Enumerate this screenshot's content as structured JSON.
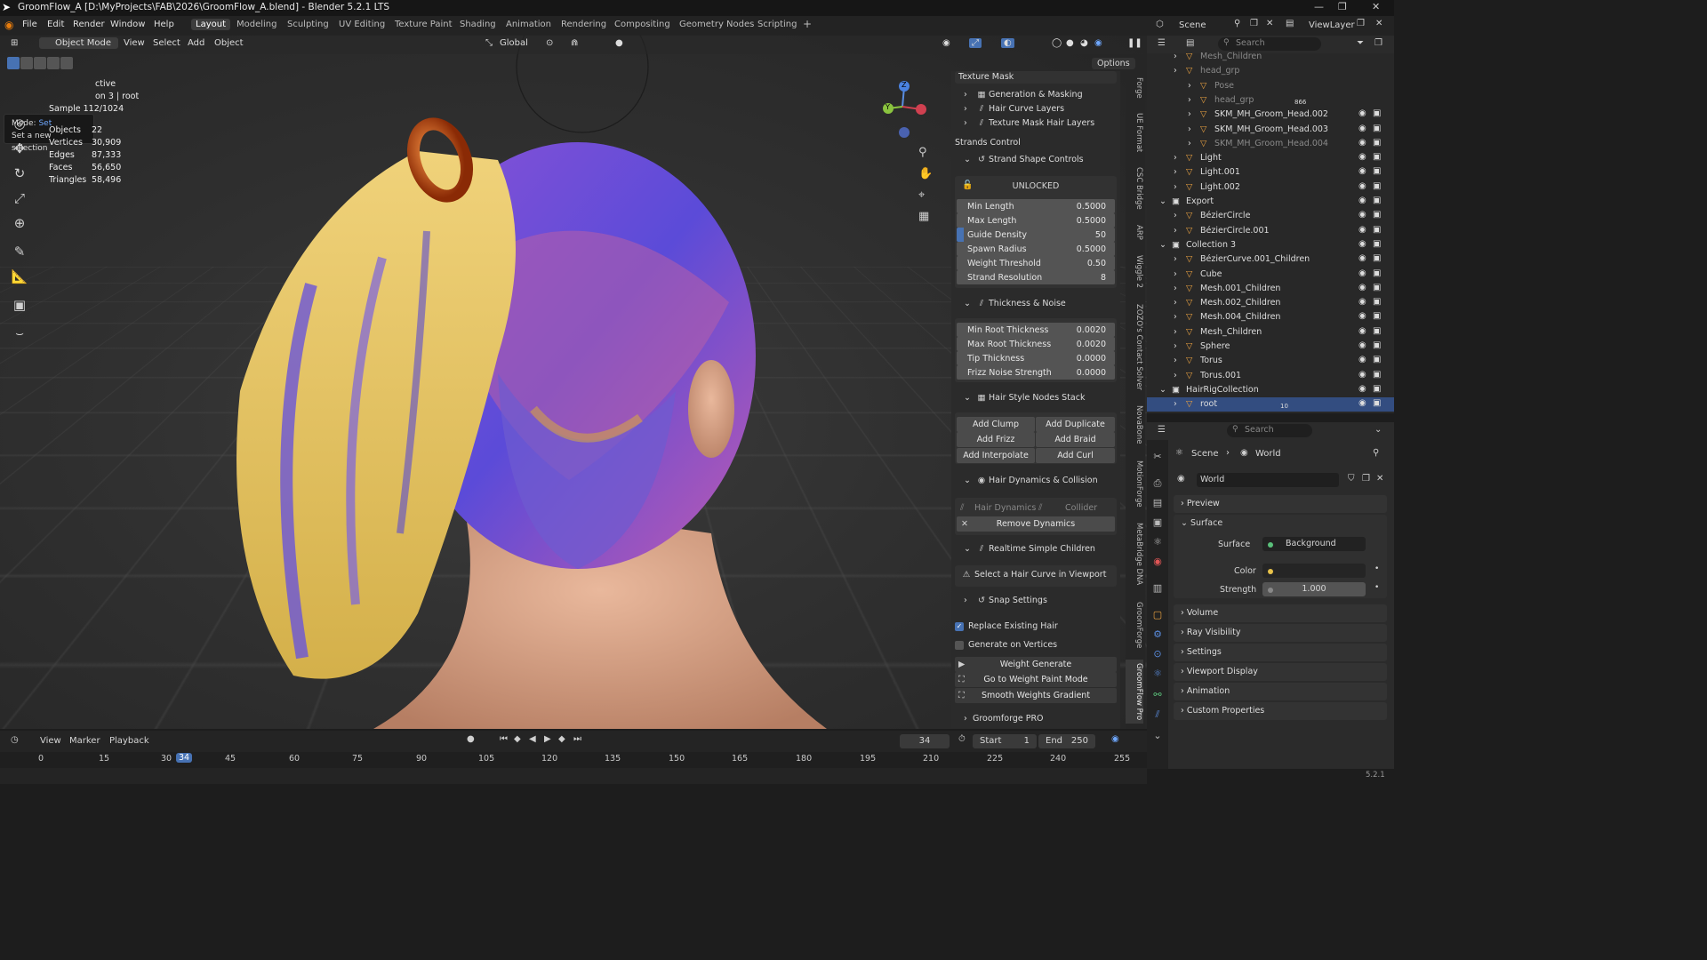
{
  "titlebar": {
    "title": "GroomFlow_A [D:\\MyProjects\\FAB\\2026\\GroomFlow_A.blend] - Blender 5.2.1 LTS"
  },
  "menu": [
    "File",
    "Edit",
    "Render",
    "Window",
    "Help"
  ],
  "workspaces": [
    "Layout",
    "Modeling",
    "Sculpting",
    "UV Editing",
    "Texture Paint",
    "Shading",
    "Animation",
    "Rendering",
    "Compositing",
    "Geometry Nodes",
    "Scripting"
  ],
  "scene": {
    "name": "Scene",
    "viewlayer": "ViewLayer"
  },
  "viewport": {
    "mode": "Object Mode",
    "view": "View",
    "select": "Select",
    "add": "Add",
    "object": "Object",
    "orientation": "Global",
    "options": "Options",
    "tooltip": {
      "line1_label": "Mode:",
      "line1_value": "Set",
      "line2": "Set a new selection"
    },
    "overlay_partial1": "ctive",
    "overlay_partial2": "on 3 | root",
    "sample": "Sample 112/1024",
    "stats": [
      {
        "k": "Objects",
        "v": "22"
      },
      {
        "k": "Vertices",
        "v": "30,909"
      },
      {
        "k": "Edges",
        "v": "87,333"
      },
      {
        "k": "Faces",
        "v": "56,650"
      },
      {
        "k": "Triangles",
        "v": "58,496"
      }
    ],
    "gizmo": {
      "z": "Z",
      "y": "Y"
    }
  },
  "npanel": {
    "texture_mask": "Texture Mask",
    "gen_masking": "Generation & Masking",
    "hair_curve_layers": "Hair Curve Layers",
    "texture_mask_layers": "Texture Mask Hair Layers",
    "strands_control": "Strands Control",
    "strand_shape": "Strand Shape Controls",
    "unlocked": "UNLOCKED",
    "shape_props": [
      {
        "k": "Min Length",
        "v": "0.5000"
      },
      {
        "k": "Max Length",
        "v": "0.5000"
      },
      {
        "k": "Guide Density",
        "v": "50"
      },
      {
        "k": "Spawn Radius",
        "v": "0.5000"
      },
      {
        "k": "Weight Threshold",
        "v": "0.50"
      },
      {
        "k": "Strand Resolution",
        "v": "8"
      }
    ],
    "thickness_noise": "Thickness & Noise",
    "thick_props": [
      {
        "k": "Min Root Thickness",
        "v": "0.0020"
      },
      {
        "k": "Max Root Thickness",
        "v": "0.0020"
      },
      {
        "k": "Tip Thickness",
        "v": "0.0000"
      },
      {
        "k": "Frizz Noise Strength",
        "v": "0.0000"
      }
    ],
    "nodes_stack": "Hair Style Nodes Stack",
    "buttons": [
      "Add Clump",
      "Add Duplicate",
      "Add Frizz",
      "Add Braid",
      "Add Interpolate",
      "Add Curl"
    ],
    "dynamics": "Hair Dynamics & Collision",
    "hair_dynamics": "Hair Dynamics",
    "collider": "Collider",
    "remove_dynamics": "Remove Dynamics",
    "realtime_children": "Realtime Simple Children",
    "select_curve": "Select a Hair Curve in Viewport",
    "snap": "Snap Settings",
    "replace_existing": "Replace Existing Hair",
    "gen_vertices": "Generate on Vertices",
    "weight_generate": "Weight Generate",
    "weight_paint": "Go to Weight Paint Mode",
    "smooth_weights": "Smooth Weights Gradient",
    "groomforge_pro": "Groomforge PRO"
  },
  "vtabs": [
    "Forge",
    "UE Format",
    "CSC Bridge",
    "ARP",
    "Wiggle 2",
    "ZOZO's Contact Solver",
    "NovaBone",
    "MotionForge",
    "MetaBridge DNA",
    "GroomForge",
    "GroomFlow Pro"
  ],
  "timeline": {
    "view": "View",
    "marker": "Marker",
    "playback": "Playback",
    "current": "34",
    "start_label": "Start",
    "start": "1",
    "end_label": "End",
    "end": "250",
    "ticks": [
      "0",
      "15",
      "30",
      "34",
      "45",
      "60",
      "75",
      "90",
      "105",
      "120",
      "135",
      "150",
      "165",
      "180",
      "195",
      "210",
      "225",
      "240",
      "255"
    ]
  },
  "outliner": {
    "search": "Search",
    "rows": [
      {
        "name": "Mesh_Children",
        "indent": 1,
        "dim": true
      },
      {
        "name": "head_grp",
        "indent": 1,
        "dim": true
      },
      {
        "name": "Pose",
        "indent": 2,
        "dim": true
      },
      {
        "name": "head_grp",
        "indent": 2,
        "dim": true,
        "extra": "866"
      },
      {
        "name": "SKM_MH_Groom_Head.002",
        "indent": 2
      },
      {
        "name": "SKM_MH_Groom_Head.003",
        "indent": 2
      },
      {
        "name": "SKM_MH_Groom_Head.004",
        "indent": 2,
        "dim": true
      },
      {
        "name": "Light",
        "indent": 1
      },
      {
        "name": "Light.001",
        "indent": 1
      },
      {
        "name": "Light.002",
        "indent": 1
      },
      {
        "name": "Export",
        "indent": 0
      },
      {
        "name": "BézierCircle",
        "indent": 1
      },
      {
        "name": "BézierCircle.001",
        "indent": 1
      },
      {
        "name": "Collection 3",
        "indent": 0
      },
      {
        "name": "BézierCurve.001_Children",
        "indent": 1
      },
      {
        "name": "Cube",
        "indent": 1
      },
      {
        "name": "Mesh.001_Children",
        "indent": 1
      },
      {
        "name": "Mesh.002_Children",
        "indent": 1
      },
      {
        "name": "Mesh.004_Children",
        "indent": 1
      },
      {
        "name": "Mesh_Children",
        "indent": 1
      },
      {
        "name": "Sphere",
        "indent": 1
      },
      {
        "name": "Torus",
        "indent": 1
      },
      {
        "name": "Torus.001",
        "indent": 1
      },
      {
        "name": "HairRigCollection",
        "indent": 0
      },
      {
        "name": "root",
        "indent": 1,
        "selected": true,
        "extra": "10"
      }
    ]
  },
  "properties": {
    "search": "Search",
    "breadcrumb_scene": "Scene",
    "breadcrumb_world": "World",
    "world_name": "World",
    "preview": "Preview",
    "surface": "Surface",
    "surface_label": "Surface",
    "surface_value": "Background",
    "color_label": "Color",
    "strength_label": "Strength",
    "strength_value": "1.000",
    "sections": [
      "Volume",
      "Ray Visibility",
      "Settings",
      "Viewport Display",
      "Animation",
      "Custom Properties"
    ]
  },
  "version": "5.2.1",
  "colors": {
    "accent": "#4772b3",
    "selected_row": "#334d80",
    "yellow": "#e8c24a",
    "orange": "#e87d0d"
  }
}
